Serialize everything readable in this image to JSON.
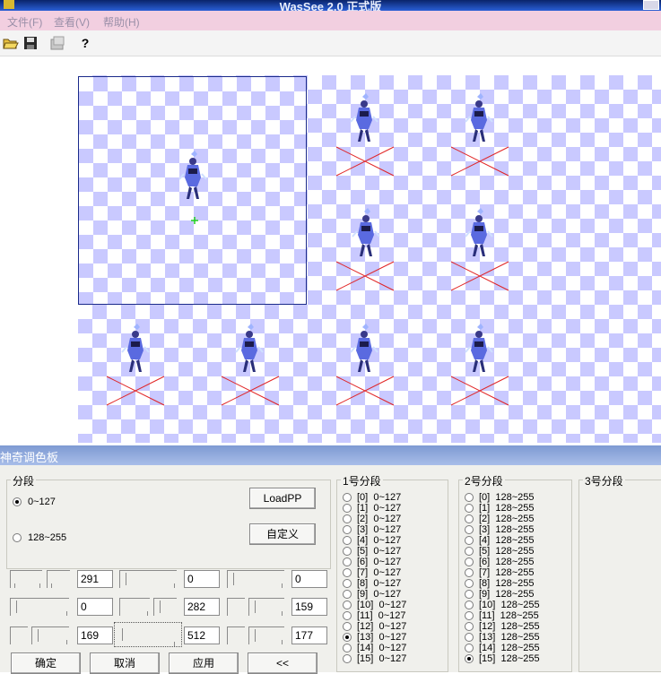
{
  "window": {
    "title": "WasSee 2.0 正式版"
  },
  "menu": {
    "items": [
      "文件(F)",
      "查看(V)",
      "帮助(H)"
    ]
  },
  "toolbar": {
    "icons": [
      "open-folder-icon",
      "save-icon",
      "export-icon",
      "help-icon"
    ],
    "help_glyph": "?"
  },
  "dialog": {
    "title": "神奇调色板",
    "segment_group": {
      "label": "分段",
      "options": [
        {
          "label": "0~127",
          "selected": true
        },
        {
          "label": "128~255",
          "selected": false
        }
      ]
    },
    "buttons": {
      "loadpp": "LoadPP",
      "custom": "自定义",
      "ok": "确定",
      "cancel": "取消",
      "apply": "应用",
      "collapse": "<<"
    },
    "values": {
      "row1": [
        "291",
        "0",
        "0"
      ],
      "row2": [
        "0",
        "282",
        "159"
      ],
      "row3": [
        "169",
        "512",
        "177"
      ]
    },
    "seg1": {
      "label": "1号分段",
      "selected_index": 13,
      "items": [
        "[0]  0~127",
        "[1]  0~127",
        "[2]  0~127",
        "[3]  0~127",
        "[4]  0~127",
        "[5]  0~127",
        "[6]  0~127",
        "[7]  0~127",
        "[8]  0~127",
        "[9]  0~127",
        "[10]  0~127",
        "[11]  0~127",
        "[12]  0~127",
        "[13]  0~127",
        "[14]  0~127",
        "[15]  0~127"
      ]
    },
    "seg2": {
      "label": "2号分段",
      "selected_index": 15,
      "items": [
        "[0]  128~255",
        "[1]  128~255",
        "[2]  128~255",
        "[3]  128~255",
        "[4]  128~255",
        "[5]  128~255",
        "[6]  128~255",
        "[7]  128~255",
        "[8]  128~255",
        "[9]  128~255",
        "[10]  128~255",
        "[11]  128~255",
        "[12]  128~255",
        "[13]  128~255",
        "[14]  128~255",
        "[15]  128~255"
      ]
    },
    "seg3": {
      "label": "3号分段"
    }
  }
}
